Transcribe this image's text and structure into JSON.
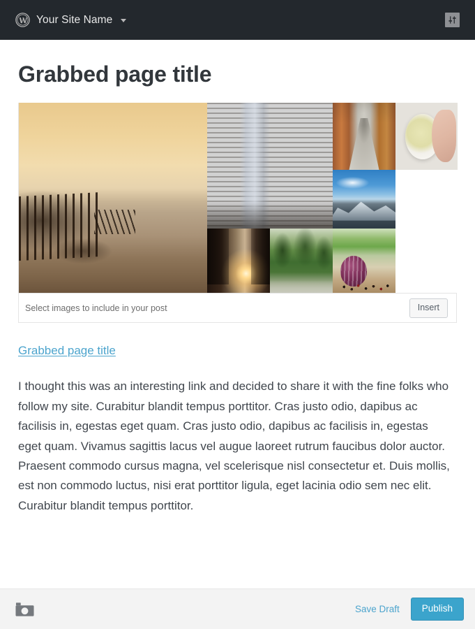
{
  "admin_bar": {
    "logo_icon": "wordpress-logo-icon",
    "site_name": "Your Site Name",
    "dropdown_icon": "chevron-down-icon",
    "options_icon": "sliders-options-icon"
  },
  "editor": {
    "post_title": "Grabbed page title",
    "media": {
      "hint": "Select images to include in your post",
      "insert_label": "Insert",
      "thumbnails": [
        {
          "name": "thumb-pier-sunset",
          "alt": "Wooden pier ruins at sunset with birds"
        },
        {
          "name": "thumb-city-skyscraper",
          "alt": "New York City street with skyscraper"
        },
        {
          "name": "thumb-alley-cobblestone",
          "alt": "Narrow cobblestone alleyway between orange buildings"
        },
        {
          "name": "thumb-tea-bowl",
          "alt": "Hand holding white bowl of lemon tea"
        },
        {
          "name": "thumb-snowy-mountain",
          "alt": "Snow covered mountain range under blue sky"
        },
        {
          "name": "thumb-street-sunrise",
          "alt": "City street at sunrise with sun flare"
        },
        {
          "name": "thumb-green-forest",
          "alt": "Green forest trees"
        },
        {
          "name": "thumb-red-onion",
          "alt": "Halved red onion with peppercorns and herbs"
        }
      ]
    },
    "source_link": "Grabbed page title",
    "body_text": "I thought this was an interesting link and decided to share it with the fine folks who follow my site. Curabitur blandit tempus porttitor. Cras justo odio, dapibus ac facilisis in, egestas eget quam. Cras justo odio, dapibus ac facilisis in, egestas eget quam. Vivamus sagittis lacus vel augue laoreet rutrum faucibus dolor auctor. Praesent commodo cursus magna, vel scelerisque nisl consectetur et. Duis mollis, est non commodo luctus, nisi erat porttitor ligula, eget lacinia odio sem nec elit. Curabitur blandit tempus porttitor."
  },
  "bottom_bar": {
    "camera_icon": "camera-icon",
    "save_draft_label": "Save Draft",
    "publish_label": "Publish"
  },
  "colors": {
    "admin_bar_bg": "#23282d",
    "link_accent": "#4ca4cd",
    "publish_bg": "#3ba4cc",
    "title_text": "#32373c",
    "body_text": "#40464d",
    "bottom_bar_bg": "#f3f3f3"
  }
}
